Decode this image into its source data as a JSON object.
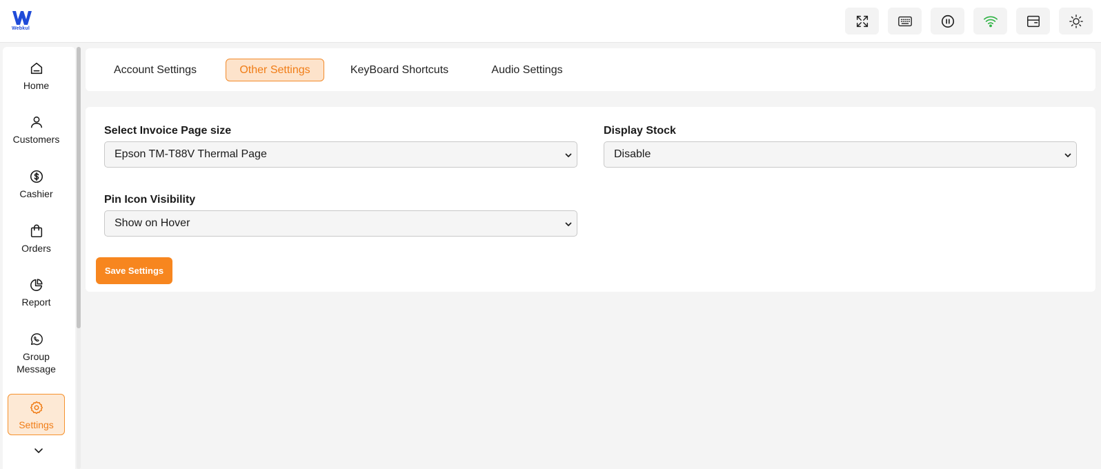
{
  "brand": {
    "name": "Webkul",
    "color": "#1f4bd8",
    "accent": "#f7861f"
  },
  "header": {
    "buttons": [
      {
        "icon": "fullscreen-icon"
      },
      {
        "icon": "keyboard-icon"
      },
      {
        "icon": "pause-icon"
      },
      {
        "icon": "wifi-icon",
        "color": "#2fb344"
      },
      {
        "icon": "register-icon"
      },
      {
        "icon": "sun-icon"
      }
    ]
  },
  "sidebar": {
    "items": [
      {
        "label": "Home",
        "icon": "home-icon"
      },
      {
        "label": "Customers",
        "icon": "user-icon"
      },
      {
        "label": "Cashier",
        "icon": "dollar-icon"
      },
      {
        "label": "Orders",
        "icon": "shopping-bag-icon"
      },
      {
        "label": "Report",
        "icon": "pie-chart-icon"
      },
      {
        "label": "Group Message",
        "icon": "whatsapp-icon"
      },
      {
        "label": "Settings",
        "icon": "gear-icon",
        "active": true
      }
    ],
    "more_icon": "chevron-down-icon"
  },
  "tabs": [
    {
      "label": "Account Settings"
    },
    {
      "label": "Other Settings",
      "active": true
    },
    {
      "label": "KeyBoard Shortcuts"
    },
    {
      "label": "Audio Settings"
    }
  ],
  "form": {
    "invoice_size": {
      "label": "Select Invoice Page size",
      "value": "Epson TM-T88V Thermal Page"
    },
    "display_stock": {
      "label": "Display Stock",
      "value": "Disable"
    },
    "pin_visibility": {
      "label": "Pin Icon Visibility",
      "value": "Show on Hover"
    },
    "save_label": "Save Settings"
  }
}
